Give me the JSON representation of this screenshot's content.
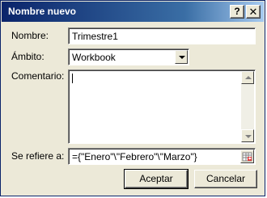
{
  "window": {
    "title": "Nombre nuevo"
  },
  "titlebar": {
    "help_label": "?",
    "close_label": "✕"
  },
  "form": {
    "name_label": "Nombre:",
    "name_value": "Trimestre1",
    "scope_label": "Ámbito:",
    "scope_value": "Workbook",
    "comment_label": "Comentario:",
    "comment_value": "",
    "refers_label": "Se refiere a:",
    "refers_value": "={\"Enero\"\\\"Febrero\"\\\"Marzo\"}"
  },
  "buttons": {
    "ok_label": "Aceptar",
    "cancel_label": "Cancelar"
  },
  "icons": {
    "scope_dropdown": "chevron-down-icon",
    "refers_collapse": "collapse-dialog-icon"
  },
  "colors": {
    "titlebar_start": "#0a246a",
    "titlebar_end": "#a6caf0",
    "face": "#ece9d8"
  }
}
